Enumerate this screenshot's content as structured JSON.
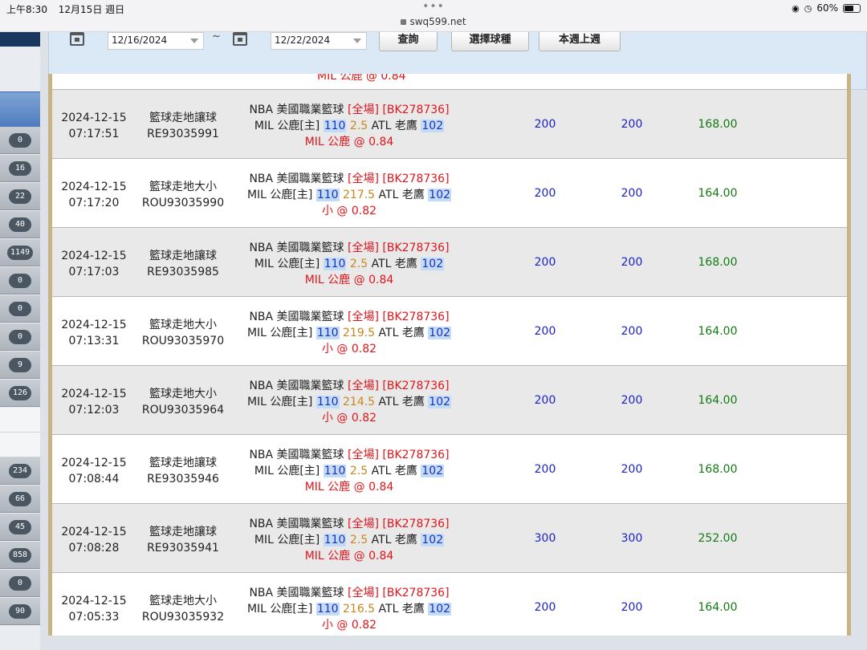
{
  "status": {
    "time": "上午8:30",
    "date": "12月15日 週日",
    "url": "swq599.net",
    "battery": "60%",
    "battery_level": 0.6
  },
  "sidebar": {
    "badges_a": [
      "0",
      "16",
      "22",
      "40",
      "1149",
      "0",
      "0",
      "0",
      "9",
      "126"
    ],
    "badges_b": [
      "234",
      "66",
      "45",
      "858",
      "0",
      "90"
    ]
  },
  "filter": {
    "date_from": "12/16/2024",
    "separator": "~",
    "date_to": "12/22/2024",
    "query_button": "查詢",
    "sport_button": "選擇球種",
    "week_button": "本週上週"
  },
  "partial_row": "MIL 公鹿 @ 0.84",
  "rows": [
    {
      "date": "2024-12-15",
      "time": "07:17:51",
      "type": "籃球走地讓球",
      "id": "RE93035991",
      "league": "NBA 美國職業籃球",
      "market": "[全場]",
      "code": "[BK278736]",
      "home": "MIL 公鹿[主]",
      "home_score": "110",
      "line": "2.5",
      "away": "ATL 老鷹",
      "away_score": "102",
      "pick": "MIL 公鹿",
      "odds": "@ 0.84",
      "bet": "200",
      "valid": "200",
      "win": "168.00"
    },
    {
      "date": "2024-12-15",
      "time": "07:17:20",
      "type": "籃球走地大小",
      "id": "ROU93035990",
      "league": "NBA 美國職業籃球",
      "market": "[全場]",
      "code": "[BK278736]",
      "home": "MIL 公鹿[主]",
      "home_score": "110",
      "line": "217.5",
      "away": "ATL 老鷹",
      "away_score": "102",
      "pick": "小",
      "odds": "@ 0.82",
      "bet": "200",
      "valid": "200",
      "win": "164.00"
    },
    {
      "date": "2024-12-15",
      "time": "07:17:03",
      "type": "籃球走地讓球",
      "id": "RE93035985",
      "league": "NBA 美國職業籃球",
      "market": "[全場]",
      "code": "[BK278736]",
      "home": "MIL 公鹿[主]",
      "home_score": "110",
      "line": "2.5",
      "away": "ATL 老鷹",
      "away_score": "102",
      "pick": "MIL 公鹿",
      "odds": "@ 0.84",
      "bet": "200",
      "valid": "200",
      "win": "168.00"
    },
    {
      "date": "2024-12-15",
      "time": "07:13:31",
      "type": "籃球走地大小",
      "id": "ROU93035970",
      "league": "NBA 美國職業籃球",
      "market": "[全場]",
      "code": "[BK278736]",
      "home": "MIL 公鹿[主]",
      "home_score": "110",
      "line": "219.5",
      "away": "ATL 老鷹",
      "away_score": "102",
      "pick": "小",
      "odds": "@ 0.82",
      "bet": "200",
      "valid": "200",
      "win": "164.00"
    },
    {
      "date": "2024-12-15",
      "time": "07:12:03",
      "type": "籃球走地大小",
      "id": "ROU93035964",
      "league": "NBA 美國職業籃球",
      "market": "[全場]",
      "code": "[BK278736]",
      "home": "MIL 公鹿[主]",
      "home_score": "110",
      "line": "214.5",
      "away": "ATL 老鷹",
      "away_score": "102",
      "pick": "小",
      "odds": "@ 0.82",
      "bet": "200",
      "valid": "200",
      "win": "164.00"
    },
    {
      "date": "2024-12-15",
      "time": "07:08:44",
      "type": "籃球走地讓球",
      "id": "RE93035946",
      "league": "NBA 美國職業籃球",
      "market": "[全場]",
      "code": "[BK278736]",
      "home": "MIL 公鹿[主]",
      "home_score": "110",
      "line": "2.5",
      "away": "ATL 老鷹",
      "away_score": "102",
      "pick": "MIL 公鹿",
      "odds": "@ 0.84",
      "bet": "200",
      "valid": "200",
      "win": "168.00"
    },
    {
      "date": "2024-12-15",
      "time": "07:08:28",
      "type": "籃球走地讓球",
      "id": "RE93035941",
      "league": "NBA 美國職業籃球",
      "market": "[全場]",
      "code": "[BK278736]",
      "home": "MIL 公鹿[主]",
      "home_score": "110",
      "line": "2.5",
      "away": "ATL 老鷹",
      "away_score": "102",
      "pick": "MIL 公鹿",
      "odds": "@ 0.84",
      "bet": "300",
      "valid": "300",
      "win": "252.00"
    },
    {
      "date": "2024-12-15",
      "time": "07:05:33",
      "type": "籃球走地大小",
      "id": "ROU93035932",
      "league": "NBA 美國職業籃球",
      "market": "[全場]",
      "code": "[BK278736]",
      "home": "MIL 公鹿[主]",
      "home_score": "110",
      "line": "216.5",
      "away": "ATL 老鷹",
      "away_score": "102",
      "pick": "小",
      "odds": "@ 0.82",
      "bet": "200",
      "valid": "200",
      "win": "164.00"
    }
  ]
}
